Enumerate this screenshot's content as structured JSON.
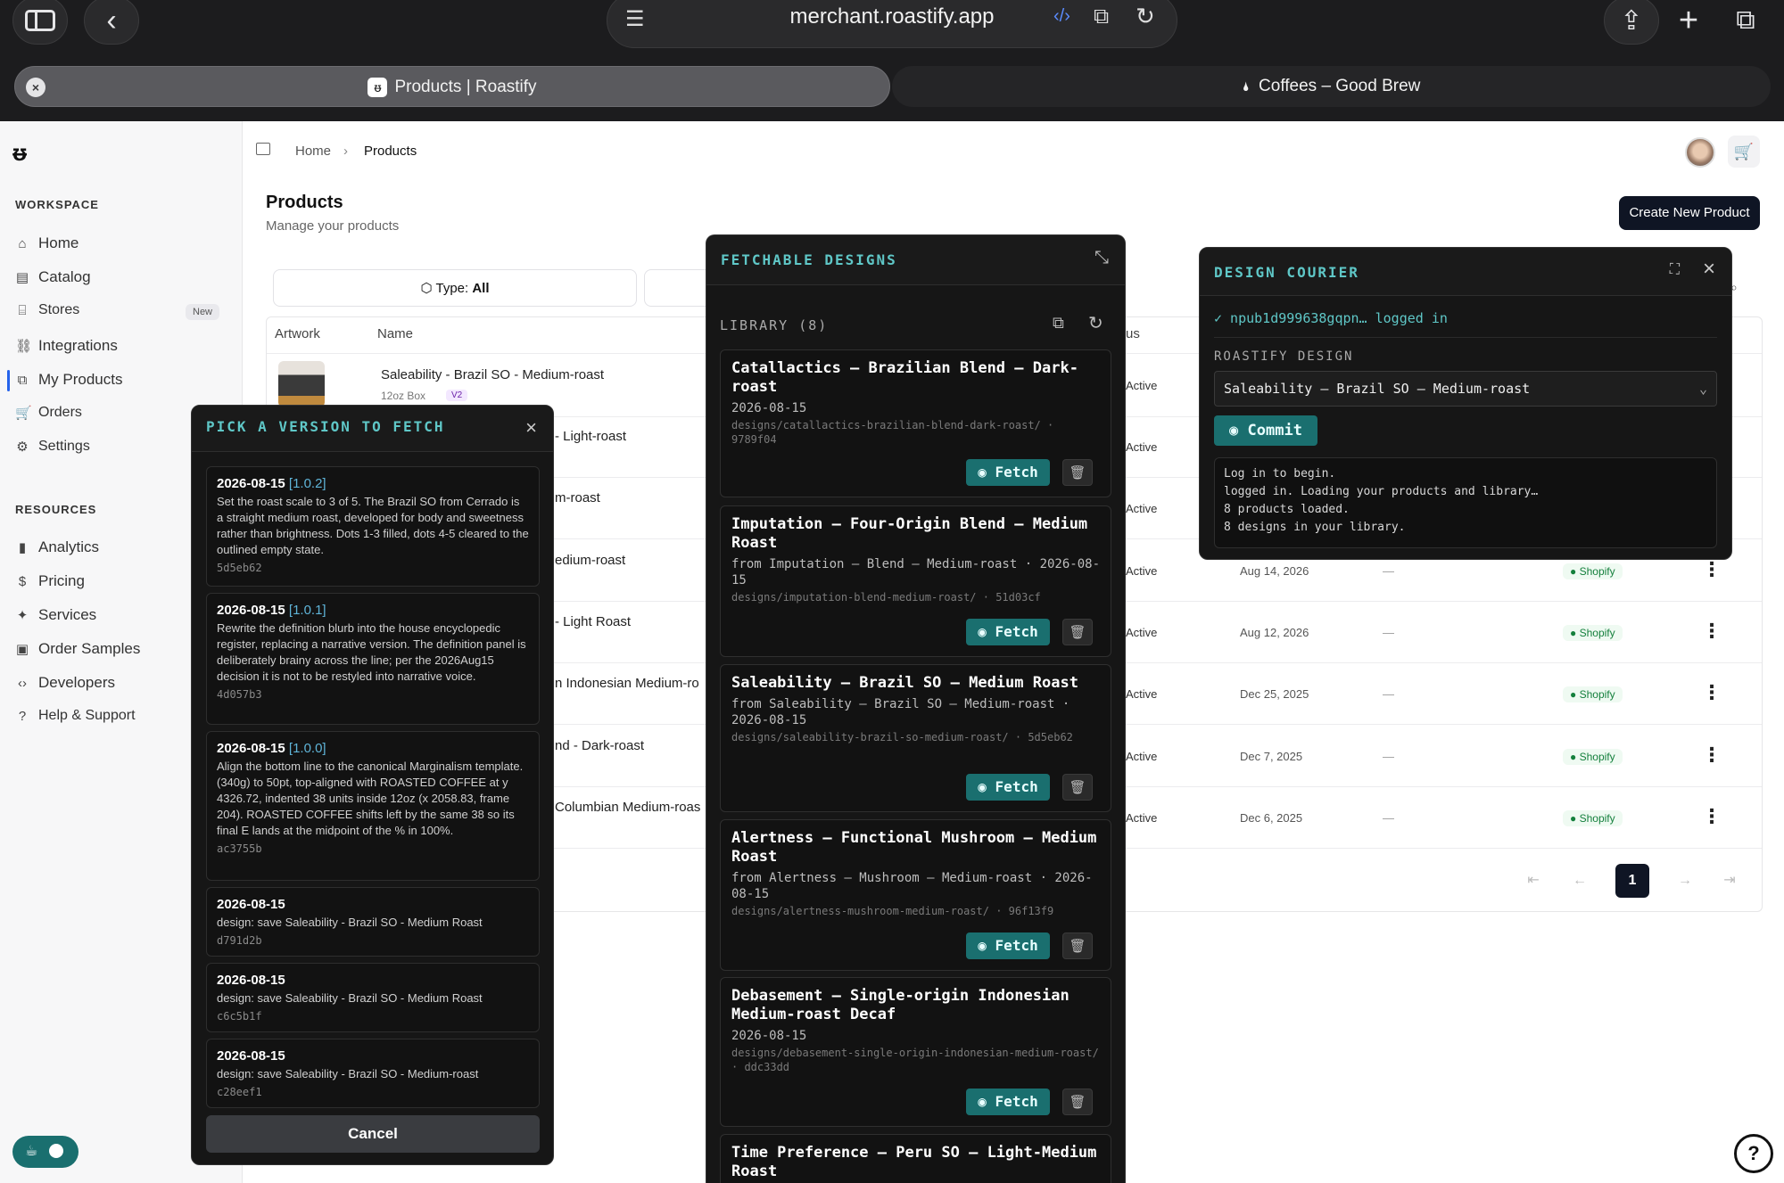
{
  "browser": {
    "url": "merchant.roastify.app",
    "tabs": [
      {
        "label": "Products | Roastify"
      },
      {
        "label": "Coffees – Good Brew"
      }
    ]
  },
  "sidebar": {
    "workspace_heading": "WORKSPACE",
    "workspace_items": [
      {
        "label": "Home",
        "icon": "home-icon"
      },
      {
        "label": "Catalog",
        "icon": "catalog-icon"
      },
      {
        "label": "Stores",
        "icon": "store-icon",
        "badge": "New"
      },
      {
        "label": "Integrations",
        "icon": "link-icon"
      },
      {
        "label": "My Products",
        "icon": "products-icon"
      },
      {
        "label": "Orders",
        "icon": "cart-icon"
      },
      {
        "label": "Settings",
        "icon": "sliders-icon"
      }
    ],
    "resources_heading": "RESOURCES",
    "resources_items": [
      {
        "label": "Analytics",
        "icon": "chart-icon"
      },
      {
        "label": "Pricing",
        "icon": "dollar-icon"
      },
      {
        "label": "Services",
        "icon": "sparkle-icon"
      },
      {
        "label": "Order Samples",
        "icon": "sample-icon"
      },
      {
        "label": "Developers",
        "icon": "code-icon"
      },
      {
        "label": "Help & Support",
        "icon": "help-icon"
      }
    ]
  },
  "breadcrumb": {
    "home": "Home",
    "current": "Products"
  },
  "page": {
    "title": "Products",
    "subtitle": "Manage your products",
    "create_button": "Create New Product"
  },
  "filters": {
    "type_label": "Type:",
    "type_value": "All"
  },
  "table": {
    "headers": {
      "artwork": "Artwork",
      "name": "Name",
      "status_partial": "us"
    },
    "first_row": {
      "name": "Saleability - Brazil SO - Medium-roast",
      "size": "12oz Box",
      "version": "V2"
    },
    "visible_names": [
      "- Light-roast",
      "m-roast",
      "edium-roast",
      "- Light Roast",
      "n Indonesian Medium-ro",
      "nd - Dark-roast",
      "Columbian Medium-roas"
    ],
    "rows": [
      {
        "status": "Active",
        "date": "",
        "dash": "",
        "channel": ""
      },
      {
        "status": "Active",
        "date": "",
        "dash": "",
        "channel": ""
      },
      {
        "status": "Active",
        "date": "",
        "dash": "",
        "channel": ""
      },
      {
        "status": "Active",
        "date": "Aug 14, 2026",
        "dash": "—",
        "channel": "Shopify"
      },
      {
        "status": "Active",
        "date": "Aug 12, 2026",
        "dash": "—",
        "channel": "Shopify"
      },
      {
        "status": "Active",
        "date": "Dec 25, 2025",
        "dash": "—",
        "channel": "Shopify"
      },
      {
        "status": "Active",
        "date": "Dec 7, 2025",
        "dash": "—",
        "channel": "Shopify"
      },
      {
        "status": "Active",
        "date": "Dec 6, 2025",
        "dash": "—",
        "channel": "Shopify"
      }
    ],
    "pagination": {
      "current": "1"
    }
  },
  "pick_panel": {
    "title": "PICK A VERSION TO FETCH",
    "versions": [
      {
        "date": "2026-08-15",
        "tag": "[1.0.2]",
        "desc": "Set the roast scale to 3 of 5. The Brazil SO from Cerrado is a straight medium roast, developed for body and sweetness rather than brightness. Dots 1-3 filled, dots 4-5 cleared to the outlined empty state.",
        "hash": "5d5eb62"
      },
      {
        "date": "2026-08-15",
        "tag": "[1.0.1]",
        "desc": "Rewrite the definition blurb into the house encyclopedic register, replacing a narrative version. The definition panel is deliberately brainy across the line; per the 2026Aug15 decision it is not to be restyled into narrative voice.",
        "hash": "4d057b3"
      },
      {
        "date": "2026-08-15",
        "tag": "[1.0.0]",
        "desc": "Align the bottom line to the canonical Marginalism template. (340g) to 50pt, top-aligned with ROASTED COFFEE at y 4326.72, indented 38 units inside 12oz (x 2058.83, frame 204). ROASTED COFFEE shifts left by the same 38 so its final E lands at the midpoint of the % in 100%.",
        "hash": "ac3755b"
      },
      {
        "date": "2026-08-15",
        "tag": "",
        "desc": "design: save Saleability - Brazil SO - Medium Roast",
        "hash": "d791d2b"
      },
      {
        "date": "2026-08-15",
        "tag": "",
        "desc": "design: save Saleability - Brazil SO - Medium Roast",
        "hash": "c6c5b1f"
      },
      {
        "date": "2026-08-15",
        "tag": "",
        "desc": "design: save Saleability - Brazil SO - Medium-roast",
        "hash": "c28eef1"
      }
    ],
    "cancel": "Cancel"
  },
  "fetch_panel": {
    "title": "FETCHABLE DESIGNS",
    "library_label": "LIBRARY (8)",
    "fetch_label": "Fetch",
    "designs": [
      {
        "title": "Catallactics – Brazilian Blend – Dark-roast",
        "meta": "2026-08-15",
        "path": "designs/catallactics-brazilian-blend-dark-roast/ · 9789f04"
      },
      {
        "title": "Imputation – Four-Origin Blend – Medium Roast",
        "meta": "from Imputation – Blend – Medium-roast · 2026-08-15",
        "path": "designs/imputation-blend-medium-roast/ · 51d03cf"
      },
      {
        "title": "Saleability – Brazil SO – Medium Roast",
        "meta": "from Saleability – Brazil SO – Medium-roast · 2026-08-15",
        "path": "designs/saleability-brazil-so-medium-roast/ · 5d5eb62"
      },
      {
        "title": "Alertness – Functional Mushroom – Medium Roast",
        "meta": "from Alertness – Mushroom – Medium-roast · 2026-08-15",
        "path": "designs/alertness-mushroom-medium-roast/ · 96f13f9"
      },
      {
        "title": "Debasement – Single-origin Indonesian Medium-roast Decaf",
        "meta": "2026-08-15",
        "path": "designs/debasement-single-origin-indonesian-medium-roast/ · ddc33dd"
      },
      {
        "title": "Time Preference – Peru SO – Light-Medium Roast",
        "meta": "",
        "path": ""
      }
    ]
  },
  "courier_panel": {
    "title": "DESIGN COURIER",
    "status": "✓ npub1d999638gqpn… logged in",
    "design_label": "ROASTIFY DESIGN",
    "selected_design": "Saleability – Brazil SO – Medium-roast",
    "commit": "Commit",
    "log": [
      "Log in to begin.",
      "logged in. Loading your products and library…",
      "8 products loaded.",
      "8 designs in your library."
    ]
  },
  "floating": {
    "left_pill_icons": "☕"
  }
}
